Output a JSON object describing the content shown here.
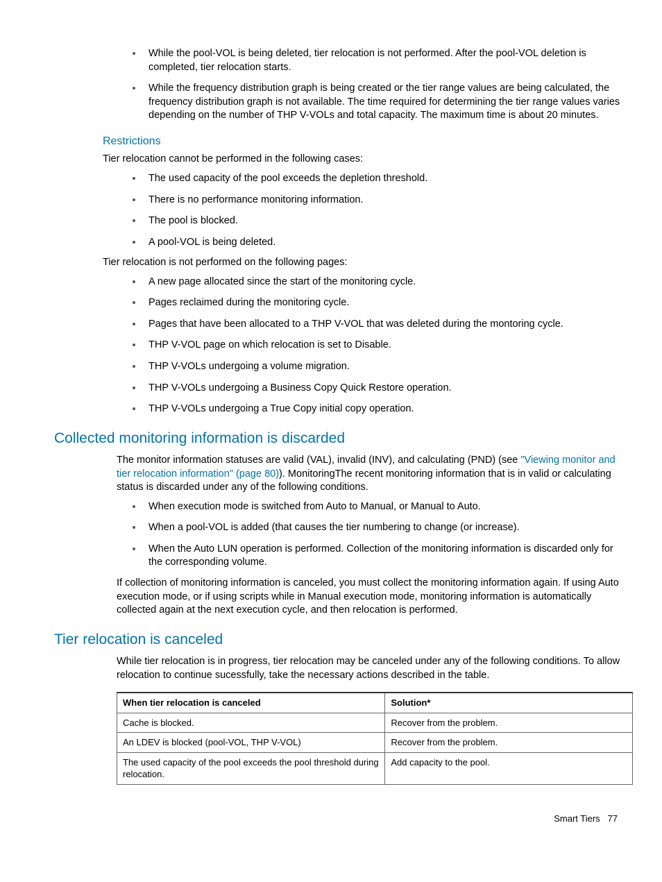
{
  "top_bullets": [
    "While the pool-VOL is being deleted, tier relocation is not performed. After the pool-VOL deletion is completed, tier relocation starts.",
    "While the frequency distribution graph is being created or the tier range values are being calculated, the frequency distribution graph is not available. The time required for determining the tier range values varies depending on the number of THP V-VOLs and total capacity. The maximum time is about 20 minutes."
  ],
  "restrictions": {
    "heading": "Restrictions",
    "intro": "Tier relocation cannot be performed in the following cases:",
    "list1": [
      "The used capacity of the pool exceeds the depletion threshold.",
      "There is no performance monitoring information.",
      "The pool is blocked.",
      "A pool-VOL is being deleted."
    ],
    "mid": "Tier relocation is not performed on the following pages:",
    "list2": [
      "A new page allocated since the start of the monitoring cycle.",
      "Pages reclaimed during the monitoring cycle.",
      "Pages that have been allocated to a THP V-VOL that was deleted during the montoring cycle.",
      "THP V-VOL page on which relocation is set to Disable.",
      "THP V-VOLs undergoing a volume migration.",
      "THP V-VOLs undergoing a Business Copy Quick Restore operation.",
      "THP V-VOLs undergoing a True Copy initial copy operation."
    ]
  },
  "collected": {
    "heading": "Collected monitoring information is discarded",
    "intro_pre": "The monitor information statuses are valid (VAL), invalid (INV), and calculating (PND) (see ",
    "link": "\"Viewing monitor and tier relocation information\" (page 80)",
    "intro_post": "). MonitoringThe recent monitoring information that is in valid or calculating status is discarded under any of the following conditions.",
    "bullets": [
      "When execution mode is switched from Auto to Manual, or Manual to Auto.",
      "When a pool-VOL is added (that causes the tier numbering to change (or increase).",
      "When the Auto LUN operation is performed. Collection of the monitoring information is discarded only for the corresponding volume."
    ],
    "outro": "If collection of monitoring information is canceled, you must collect the monitoring information again. If using Auto execution mode, or if using scripts while in Manual execution mode, monitoring information is automatically collected again at the next execution cycle, and then relocation is performed."
  },
  "canceled": {
    "heading": "Tier relocation is canceled",
    "intro": "While tier relocation is in progress, tier relocation may be canceled under any of the following conditions. To allow relocation to continue sucessfully, take the necessary actions described in the table.",
    "table": {
      "headers": [
        "When tier relocation is canceled",
        "Solution*"
      ],
      "rows": [
        [
          "Cache is blocked.",
          "Recover from the problem."
        ],
        [
          "An LDEV is blocked (pool-VOL, THP V-VOL)",
          "Recover from the problem."
        ],
        [
          "The used capacity of the pool exceeds the pool threshold during relocation.",
          "Add capacity to the pool."
        ]
      ]
    }
  },
  "footer": {
    "section": "Smart Tiers",
    "page": "77"
  }
}
